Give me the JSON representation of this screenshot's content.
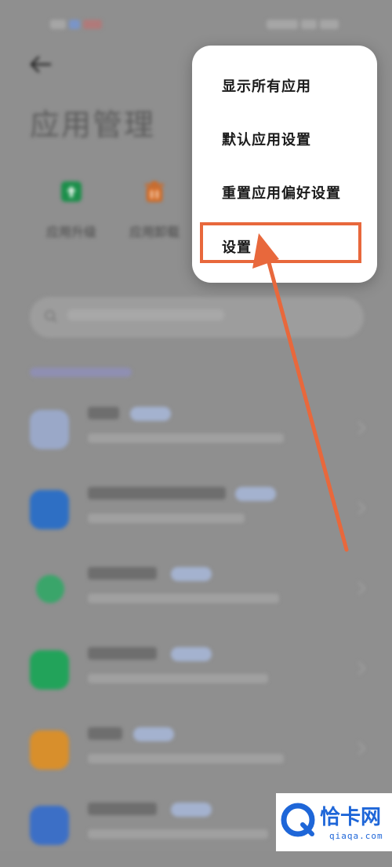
{
  "page": {
    "title": "应用管理",
    "tools": [
      {
        "label": "应用升级",
        "icon": "app-upgrade-icon",
        "color": "#1b8f4a"
      },
      {
        "label": "应用卸载",
        "icon": "trash-icon",
        "color": "#d3661d"
      }
    ],
    "section_label": "",
    "apps": [
      {
        "name": "",
        "icon": "baidu-map-app-icon",
        "color": "#3b6fc6"
      },
      {
        "name": "",
        "icon": "baidu-input-app-icon",
        "color": "#2e6fc4"
      },
      {
        "name": "",
        "icon": "green-app-icon",
        "color": "#3aa56a"
      },
      {
        "name": "",
        "icon": "phone-app-icon",
        "color": "#22a35a"
      },
      {
        "name": "",
        "icon": "message-app-icon",
        "color": "#d88f2c"
      },
      {
        "name": "",
        "icon": "blue-app-icon",
        "color": "#3c6fc6"
      }
    ]
  },
  "menu": {
    "items": [
      {
        "label": "显示所有应用"
      },
      {
        "label": "默认应用设置"
      },
      {
        "label": "重置应用偏好设置"
      },
      {
        "label": "设置"
      }
    ]
  },
  "colors": {
    "highlight": "#e8683c",
    "arrow": "#e8683c",
    "watermark": "#1e66d8"
  },
  "watermark": {
    "brand": "恰卡网",
    "url": "qiaqa.com"
  }
}
